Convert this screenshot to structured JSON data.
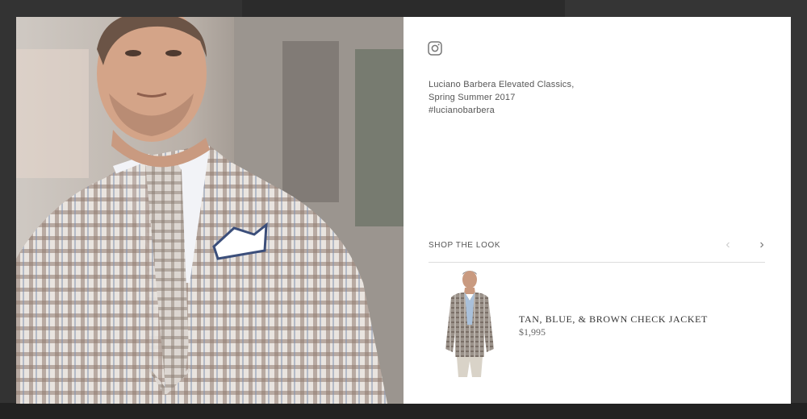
{
  "post": {
    "caption_lines": [
      "Luciano Barbera Elevated Classics,",
      "Spring Summer 2017",
      "#lucianobarbera"
    ],
    "social_icon": "instagram-icon"
  },
  "shop": {
    "label": "SHOP THE LOOK",
    "prev_icon": "chevron-left-icon",
    "next_icon": "chevron-right-icon",
    "prev_glyph": "‹",
    "next_glyph": "›"
  },
  "product": {
    "name": "TAN, BLUE, & BROWN CHECK JACKET",
    "price": "$1,995"
  },
  "colors": {
    "background_overlay": "#2f2f2f",
    "panel": "#ffffff",
    "text": "#555555"
  }
}
